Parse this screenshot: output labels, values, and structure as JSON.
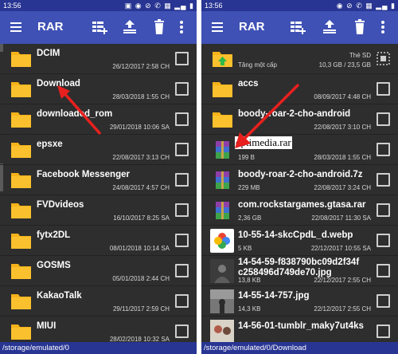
{
  "left": {
    "status_time": "13:56",
    "status_icons": "▣ ◉ ⊘ ✆ ▦ ▂▄ ▮",
    "app_title": "RAR",
    "path": "/storage/emulated/0",
    "items": [
      {
        "name": "DCIM",
        "date": "26/12/2017 2:58 CH"
      },
      {
        "name": "Download",
        "date": "28/03/2018 1:55 CH"
      },
      {
        "name": "downloaded_rom",
        "date": "29/01/2018 10:06 SA"
      },
      {
        "name": "epsxe",
        "date": "22/08/2017 3:13 CH"
      },
      {
        "name": "Facebook Messenger",
        "date": "24/08/2017 4:57 CH"
      },
      {
        "name": "FVDvideos",
        "date": "16/10/2017 8:25 SA"
      },
      {
        "name": "fytx2DL",
        "date": "08/01/2018 10:14 SA"
      },
      {
        "name": "GOSMS",
        "date": "05/01/2018 2:44 CH"
      },
      {
        "name": "KakaoTalk",
        "date": "29/11/2017 2:59 CH"
      },
      {
        "name": "MIUI",
        "date": "28/02/2018 10:32 SA"
      }
    ]
  },
  "right": {
    "status_time": "13:56",
    "status_icons": "◉ ⊘ ✆ ▦ ▂▄ ▮",
    "app_title": "RAR",
    "path": "/storage/emulated/0/Download",
    "up": {
      "label": "Tăng một cấp",
      "storage_title": "Thẻ SD",
      "storage_size": "10,3 GB / 23,5 GB"
    },
    "items": [
      {
        "name": "accs",
        "date": "08/09/2017 4:48 CH",
        "size": "",
        "type": "folder"
      },
      {
        "name": "boody-roar-2-cho-android",
        "date": "22/08/2017 3:10 CH",
        "size": "",
        "type": "folder"
      },
      {
        "name": "optimedia.rar",
        "date": "28/03/2018 1:55 CH",
        "size": "199 B",
        "type": "rar",
        "annotation": "optimedia.rar"
      },
      {
        "name": "boody-roar-2-cho-android.7z",
        "date": "22/08/2017 3:24 CH",
        "size": "229 MB",
        "type": "rar"
      },
      {
        "name": "com.rockstargames.gtasa.rar",
        "date": "22/08/2017 11:30 SA",
        "size": "2,36 GB",
        "type": "rar"
      },
      {
        "name": "10-55-14-skcCpdL_d.webp",
        "date": "22/12/2017 10:55 SA",
        "size": "5 KB",
        "type": "photos"
      },
      {
        "name": "14-54-59-f838790bc09d2f34f\nc258496d749de70.jpg",
        "date": "22/12/2017 2:55 CH",
        "size": "13,8 KB",
        "type": "img1"
      },
      {
        "name": "14-55-14-757.jpg",
        "date": "22/12/2017 2:55 CH",
        "size": "14,3 KB",
        "type": "img2"
      },
      {
        "name": "14-56-01-tumblr_maky7ut4ks",
        "date": "",
        "size": "",
        "type": "img3"
      }
    ]
  },
  "colors": {
    "appbar": "#3f51b5",
    "statusbar": "#283593",
    "background": "#2e2e2e",
    "folder": "#f5b31a",
    "annotation_arrow": "#e8201e"
  }
}
